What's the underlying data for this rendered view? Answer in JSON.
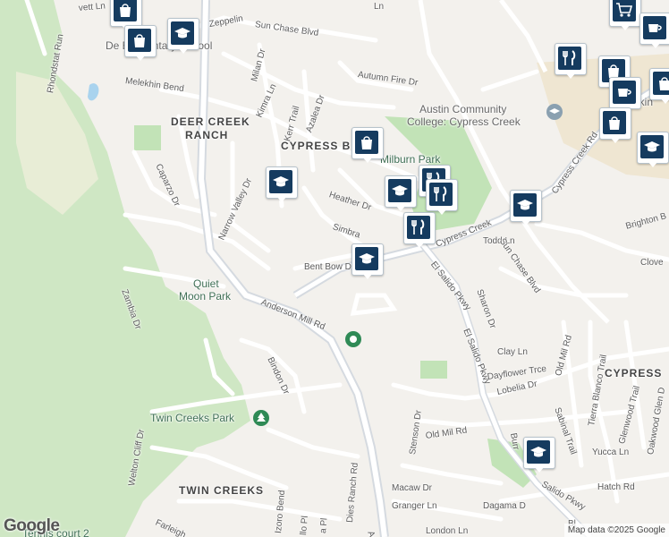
{
  "map": {
    "area_labels": [
      {
        "id": "deer-creek-1",
        "text": "DEER CREEK"
      },
      {
        "id": "deer-creek-2",
        "text": "RANCH"
      },
      {
        "id": "cypress-b",
        "text": "CYPRESS B"
      },
      {
        "id": "twin-creeks",
        "text": "TWIN CREEKS"
      },
      {
        "id": "cypress-right",
        "text": "CYPRESS"
      }
    ],
    "poi_labels": [
      {
        "id": "elementary",
        "text": "De        Elementary School"
      },
      {
        "id": "milburn",
        "text": "Milburn Park"
      },
      {
        "id": "acc-1",
        "text": "Austin Community"
      },
      {
        "id": "acc-2",
        "text": "College: Cypress Creek"
      },
      {
        "id": "quiet-1",
        "text": "Quiet"
      },
      {
        "id": "quiet-2",
        "text": "Moon Park"
      },
      {
        "id": "twin-park",
        "text": "Twin Creeks Park"
      },
      {
        "id": "tennis",
        "text": "Tennis court 2"
      },
      {
        "id": "ekin",
        "text": "ekin"
      }
    ],
    "street_labels": [
      {
        "id": "s1",
        "text": "Zeppelin"
      },
      {
        "id": "s2",
        "text": "Sun Chase Blvd"
      },
      {
        "id": "s3",
        "text": "Milan Dr"
      },
      {
        "id": "s4",
        "text": "Rhondstat Run"
      },
      {
        "id": "s5",
        "text": "Melekhin Bend"
      },
      {
        "id": "s6",
        "text": "Kimra Ln"
      },
      {
        "id": "s7",
        "text": "Kerr Trail"
      },
      {
        "id": "s8",
        "text": "Azalea Dr"
      },
      {
        "id": "s9",
        "text": "Autumn Fire Dr"
      },
      {
        "id": "s10",
        "text": "Caparzo Dr"
      },
      {
        "id": "s11",
        "text": "Narrow Valley Dr"
      },
      {
        "id": "s12",
        "text": "Heather Dr"
      },
      {
        "id": "s13",
        "text": "Simbra"
      },
      {
        "id": "s14",
        "text": "Bent Bow D"
      },
      {
        "id": "s15",
        "text": "Cypress Creek"
      },
      {
        "id": "s16",
        "text": "Cypress Creek Rd"
      },
      {
        "id": "s17",
        "text": "Todd Ln"
      },
      {
        "id": "s18",
        "text": "Sun Chase Blvd"
      },
      {
        "id": "s19",
        "text": "El Salido Pkwy"
      },
      {
        "id": "s20",
        "text": "El Salido Pkwy"
      },
      {
        "id": "s21",
        "text": "Sharon Dr"
      },
      {
        "id": "s22",
        "text": "Zambia Dr"
      },
      {
        "id": "s23",
        "text": "Anderson Mill Rd"
      },
      {
        "id": "s24",
        "text": "Bindon Dr"
      },
      {
        "id": "s25",
        "text": "Clay Ln"
      },
      {
        "id": "s26",
        "text": "Dayflower Trce"
      },
      {
        "id": "s27",
        "text": "Lobelia Dr"
      },
      {
        "id": "s28",
        "text": "Old Mil Rd"
      },
      {
        "id": "s29",
        "text": "Tierra Blanco Trail"
      },
      {
        "id": "s30",
        "text": "Glenwood Trail"
      },
      {
        "id": "s31",
        "text": "Oakwood Glen D"
      },
      {
        "id": "s32",
        "text": "Sabinal Trail"
      },
      {
        "id": "s33",
        "text": "Yucca Ln"
      },
      {
        "id": "s34",
        "text": "Old Mil Rd"
      },
      {
        "id": "s35",
        "text": "Stenson Dr"
      },
      {
        "id": "s36",
        "text": "Macaw Dr"
      },
      {
        "id": "s37",
        "text": "Granger Ln"
      },
      {
        "id": "s38",
        "text": "Dagama D"
      },
      {
        "id": "s39",
        "text": "Salido Pkwy"
      },
      {
        "id": "s40",
        "text": "Hatch Rd"
      },
      {
        "id": "s41",
        "text": "Welton Cliff Dr"
      },
      {
        "id": "s42",
        "text": "Farleigh"
      },
      {
        "id": "s43",
        "text": "Izoro Bend"
      },
      {
        "id": "s44",
        "text": "Dies Ranch Rd"
      },
      {
        "id": "s45",
        "text": "Brighton B"
      },
      {
        "id": "s46",
        "text": "Clove"
      },
      {
        "id": "s47",
        "text": "Burr"
      },
      {
        "id": "s48",
        "text": "London Ln"
      },
      {
        "id": "s49",
        "text": "vett Ln"
      },
      {
        "id": "s50",
        "text": "Ln"
      },
      {
        "id": "s51",
        "text": "Ande"
      },
      {
        "id": "s52",
        "text": "Bl"
      },
      {
        "id": "s53",
        "text": "a Pl"
      },
      {
        "id": "s54",
        "text": "llo Pl"
      }
    ],
    "pins": [
      {
        "id": "pin-shopping-1",
        "icon": "shopping-bag-icon"
      },
      {
        "id": "pin-shopping-2",
        "icon": "shopping-bag-icon"
      },
      {
        "id": "pin-school-1",
        "icon": "graduation-cap-icon"
      },
      {
        "id": "pin-shopping-3",
        "icon": "shopping-bag-icon"
      },
      {
        "id": "pin-school-2",
        "icon": "graduation-cap-icon"
      },
      {
        "id": "pin-school-3",
        "icon": "graduation-cap-icon"
      },
      {
        "id": "pin-restaurant-1",
        "icon": "fork-knife-icon"
      },
      {
        "id": "pin-restaurant-2",
        "icon": "fork-knife-icon"
      },
      {
        "id": "pin-restaurant-3",
        "icon": "fork-knife-icon"
      },
      {
        "id": "pin-school-4",
        "icon": "graduation-cap-icon"
      },
      {
        "id": "pin-school-5",
        "icon": "graduation-cap-icon"
      },
      {
        "id": "pin-school-6",
        "icon": "graduation-cap-icon"
      },
      {
        "id": "pin-cart-1",
        "icon": "shopping-cart-icon"
      },
      {
        "id": "pin-coffee-1",
        "icon": "coffee-cup-icon"
      },
      {
        "id": "pin-restaurant-4",
        "icon": "fork-knife-icon"
      },
      {
        "id": "pin-shopping-4",
        "icon": "shopping-bag-icon"
      },
      {
        "id": "pin-coffee-2",
        "icon": "coffee-cup-icon"
      },
      {
        "id": "pin-shopping-5",
        "icon": "shopping-bag-icon"
      },
      {
        "id": "pin-school-7",
        "icon": "graduation-cap-icon"
      },
      {
        "id": "pin-shopping-6",
        "icon": "shopping-bag-icon"
      }
    ],
    "logo": "Google",
    "attribution": "Map data ©2025 Google",
    "colors": {
      "background": "#f3f1ed",
      "green_area": "#cfe7c4",
      "park": "#c2e3b7",
      "road": "#ffffff",
      "major_road": "#dfe3e8",
      "pin_fill": "#153b5f",
      "water": "#a9d3ee"
    }
  }
}
